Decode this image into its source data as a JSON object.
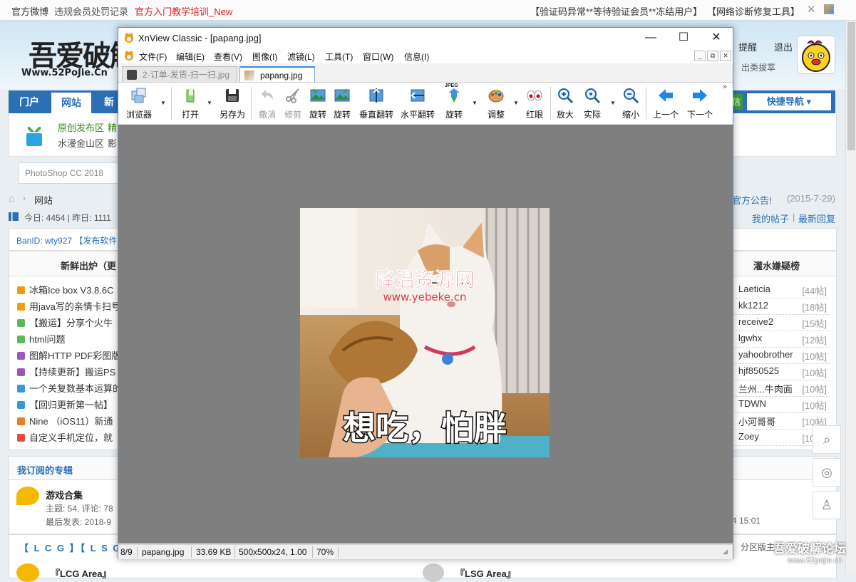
{
  "topbar": {
    "link1": "官方微博",
    "link2": "违规会员处罚记录",
    "link3": "官方入门教学培训_New",
    "notice1": "【验证码异常**等待验证会员**冻结用户】",
    "notice2": "【网络诊断修复工具】"
  },
  "site": {
    "logo": "吾爱破解",
    "logo_url": "Www.52PoJie.Cn",
    "remind": "提醒",
    "logout": "退出",
    "user_group": "出类拔萃"
  },
  "nav": {
    "tab_home": "门户",
    "tab_forum": "网站",
    "tab_new": "新",
    "quick_nav": "快捷导航",
    "extra": "信"
  },
  "forum_info": {
    "line1_a": "原创发布区",
    "line1_b": "精",
    "line2_a": "水漫金山区",
    "line2_b": "影"
  },
  "search": {
    "placeholder": "PhotoShop CC 2018"
  },
  "breadcrumb": {
    "current": "网站"
  },
  "stats": {
    "text": "今日: 4454 | 昨日: 1111"
  },
  "announcement": {
    "text": "官方公告!",
    "date": "(2015-7-29)"
  },
  "user_links": {
    "my_posts": "我的帖子",
    "latest_reply": "最新回复"
  },
  "banid": {
    "text": "BanID:  wty927  【发布软件"
  },
  "fresh": {
    "header": "新鲜出炉（更",
    "items": [
      {
        "text": "冰箱Ice box V3.8.6C",
        "color": "#f39c12"
      },
      {
        "text": "用java写的亲情卡扫号",
        "color": "#f39c12"
      },
      {
        "text": "【搬运】分享个火牛",
        "color": "#5cb85c"
      },
      {
        "text": "html问题",
        "color": "#5cb85c"
      },
      {
        "text": "图解HTTP PDF彩图版",
        "color": "#9b59b6"
      },
      {
        "text": "【持续更新】搬运PS",
        "color": "#9b59b6"
      },
      {
        "text": "一个关复数基本运算的",
        "color": "#3498db"
      },
      {
        "text": "【回归更新第一帖】",
        "color": "#3498db"
      },
      {
        "text": "Nine （iOS11）新通",
        "color": "#e67e22"
      },
      {
        "text": "自定义手机定位，就",
        "color": "#e74c3c"
      }
    ]
  },
  "ranking": {
    "header": "灌水嫌疑榜",
    "items": [
      {
        "name": "Laeticia",
        "count": "[44帖]"
      },
      {
        "name": "kk1212",
        "count": "[18帖]"
      },
      {
        "name": "receive2",
        "count": "[15帖]"
      },
      {
        "name": "lgwhx",
        "count": "[12帖]"
      },
      {
        "name": "yahoobrother",
        "count": "[10帖]"
      },
      {
        "name": "hjf850525",
        "count": "[10帖]"
      },
      {
        "name": "兰州...牛肉面",
        "count": "[10帖]"
      },
      {
        "name": "TDWN",
        "count": "[10帖]"
      },
      {
        "name": "小河哥哥",
        "count": "[10帖]"
      },
      {
        "name": "Zoey",
        "count": "[10帖]"
      }
    ]
  },
  "subscribed": {
    "header": "我订阅的专辑",
    "title": "游戏合集",
    "meta": "主题: 54, 评论: 78",
    "last": "最后发表: 2018-9",
    "last_time": "4 15:01"
  },
  "lcg": {
    "tags": "【 L C G 】【 L S G",
    "area1": "『LCG Area』",
    "area2": "『LSG Area』",
    "sub_forum": "分区版主"
  },
  "watermark": {
    "text": "吾爱破解论坛",
    "url": "www.52pojie.cn"
  },
  "xnview": {
    "title": "XnView Classic - [papang.jpg]",
    "menu": [
      "文件(F)",
      "编辑(E)",
      "查看(V)",
      "图像(I)",
      "滤镜(L)",
      "工具(T)",
      "窗口(W)",
      "信息(I)"
    ],
    "tabs": [
      {
        "label": "2-订单-发货-扫一扫.jpg",
        "active": false
      },
      {
        "label": "papang.jpg",
        "active": true
      }
    ],
    "toolbar": {
      "browser": "浏览器",
      "open": "打开",
      "save_as": "另存为",
      "undo": "撤消",
      "crop": "修剪",
      "rotate_left": "旋转",
      "rotate_right": "旋转",
      "flip_v": "垂直翻转",
      "flip_h": "水平翻转",
      "rotate_jpeg": "旋转",
      "jpeg_badge": "JPEG",
      "adjust": "调整",
      "red_eye": "红眼",
      "zoom_in": "放大",
      "actual": "实际",
      "zoom_out": "缩小",
      "prev": "上一个",
      "next": "下一个"
    },
    "image": {
      "watermark": "降温资源网",
      "watermark_url": "www.yebeke.cn",
      "caption": "想吃，怕胖"
    },
    "status": {
      "index": "8/9",
      "filename": "papang.jpg",
      "size": "33.69 KB",
      "dims": "500x500x24, 1.00",
      "zoom": "70%"
    }
  }
}
